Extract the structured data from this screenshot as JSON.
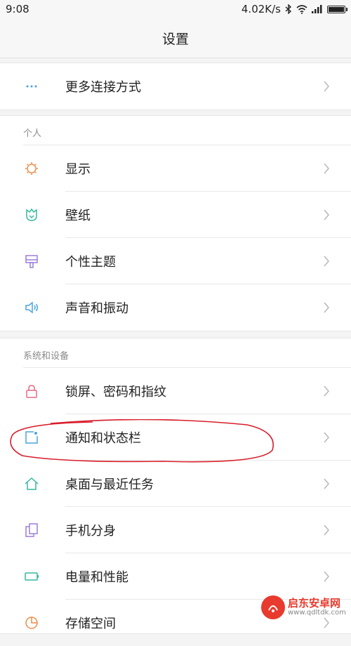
{
  "status_bar": {
    "time": "9:08",
    "speed": "4.02K/s"
  },
  "title": "设置",
  "section_top": [
    {
      "label": "更多连接方式",
      "icon": "more-dots-icon"
    }
  ],
  "section_personal": {
    "header": "个人",
    "items": [
      {
        "label": "显示",
        "icon": "sun-icon"
      },
      {
        "label": "壁纸",
        "icon": "tulip-icon"
      },
      {
        "label": "个性主题",
        "icon": "theme-brush-icon"
      },
      {
        "label": "声音和振动",
        "icon": "speaker-icon"
      }
    ]
  },
  "section_system": {
    "header": "系统和设备",
    "items": [
      {
        "label": "锁屏、密码和指纹",
        "icon": "lock-icon"
      },
      {
        "label": "通知和状态栏",
        "icon": "notification-icon"
      },
      {
        "label": "桌面与最近任务",
        "icon": "home-icon"
      },
      {
        "label": "手机分身",
        "icon": "clone-icon"
      },
      {
        "label": "电量和性能",
        "icon": "battery-icon"
      },
      {
        "label": "存储空间",
        "icon": "storage-pie-icon"
      }
    ]
  },
  "colors": {
    "orange": "#f08c47",
    "teal": "#35b9a0",
    "purple": "#9b7fd8",
    "blue": "#4aa3df",
    "pink": "#e56b86",
    "red_annotation": "#d81e2b"
  },
  "watermark": {
    "main": "启东安卓网",
    "sub": "www.qdltdk.com"
  }
}
